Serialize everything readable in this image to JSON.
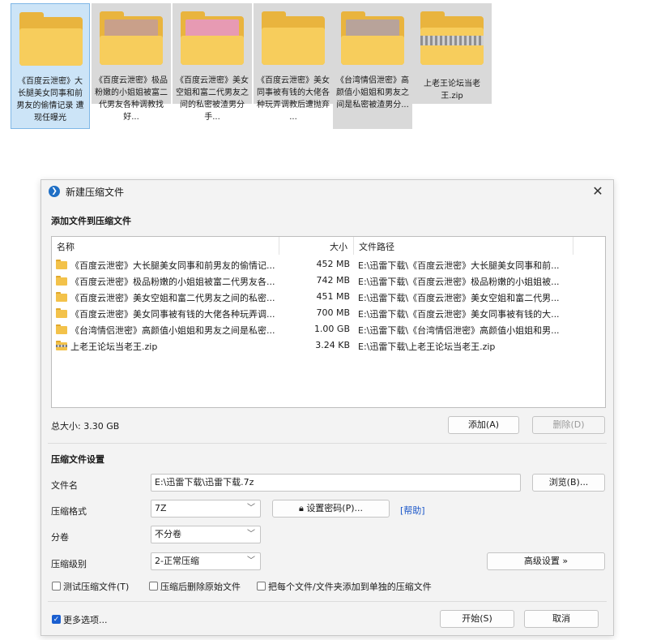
{
  "desktop_files": [
    {
      "name": "《百度云泄密》大长腿美女同事和前男友的偷情记录 遭现任曝光",
      "type": "folder",
      "thumb": "#f7cd5c"
    },
    {
      "name": "《百度云泄密》极品粉嫩的小姐姐被富二代男友各种调教找好...",
      "type": "folder",
      "thumb": "#c9a08a"
    },
    {
      "name": "《百度云泄密》美女空姐和富二代男友之间的私密被渣男分手...",
      "type": "folder",
      "thumb": "#e79ab3"
    },
    {
      "name": "《百度云泄密》美女同事被有钱的大佬各种玩弄调教后遭抛弃 ...",
      "type": "folder",
      "thumb": "#f7cd5c"
    },
    {
      "name": "《台湾情侣泄密》高颜值小姐姐和男友之间是私密被渣男分...",
      "type": "folder",
      "thumb": "#b8a39a"
    },
    {
      "name": "上老王论坛当老王.zip",
      "type": "zip",
      "thumb": "#f7cd5c"
    }
  ],
  "dialog": {
    "title": "新建压缩文件",
    "close_glyph": "✕",
    "add_section_label": "添加文件到压缩文件",
    "columns": {
      "name": "名称",
      "size": "大小",
      "path": "文件路径"
    },
    "rows": [
      {
        "name": "《百度云泄密》大长腿美女同事和前男友的偷情记...",
        "size": "452 MB",
        "path": "E:\\迅雷下载\\《百度云泄密》大长腿美女同事和前...",
        "icon": "folder"
      },
      {
        "name": "《百度云泄密》极品粉嫩的小姐姐被富二代男友各...",
        "size": "742 MB",
        "path": "E:\\迅雷下载\\《百度云泄密》极品粉嫩的小姐姐被...",
        "icon": "folder"
      },
      {
        "name": "《百度云泄密》美女空姐和富二代男友之间的私密...",
        "size": "451 MB",
        "path": "E:\\迅雷下载\\《百度云泄密》美女空姐和富二代男...",
        "icon": "folder"
      },
      {
        "name": "《百度云泄密》美女同事被有钱的大佬各种玩弄调...",
        "size": "700 MB",
        "path": "E:\\迅雷下载\\《百度云泄密》美女同事被有钱的大...",
        "icon": "folder"
      },
      {
        "name": "《台湾情侣泄密》高颜值小姐姐和男友之间是私密...",
        "size": "1.00 GB",
        "path": "E:\\迅雷下载\\《台湾情侣泄密》高颜值小姐姐和男...",
        "icon": "folder"
      },
      {
        "name": "上老王论坛当老王.zip",
        "size": "3.24 KB",
        "path": "E:\\迅雷下载\\上老王论坛当老王.zip",
        "icon": "zip"
      }
    ],
    "total_size": "总大小: 3.30 GB",
    "add_button": "添加(A)",
    "remove_button": "删除(D)",
    "settings_section_label": "压缩文件设置",
    "filename_label": "文件名",
    "filename_value": "E:\\迅雷下载\\迅雷下载.7z",
    "browse_button": "浏览(B)...",
    "format_label": "压缩格式",
    "format_value": "7Z",
    "set_password_button": "设置密码(P)...",
    "help_link": "[帮助]",
    "split_label": "分卷",
    "split_value": "不分卷",
    "level_label": "压缩级别",
    "level_value": "2-正常压缩",
    "advanced_button": "高级设置 »",
    "check_test": "测试压缩文件(T)",
    "check_delete": "压缩后删除原始文件",
    "check_separate": "把每个文件/文件夹添加到单独的压缩文件",
    "more_options": "更多选项...",
    "start_button": "开始(S)",
    "cancel_button": "取消"
  }
}
